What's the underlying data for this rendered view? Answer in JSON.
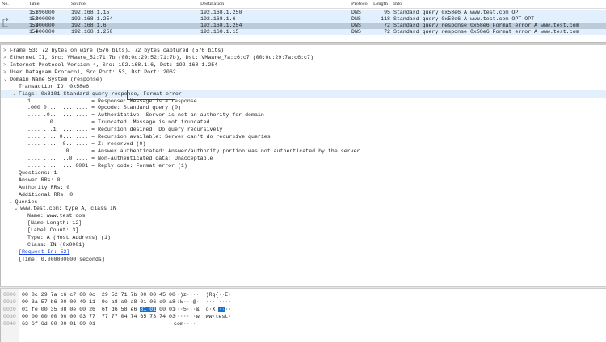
{
  "packet_list": {
    "columns": [
      "No.",
      "Time",
      "Source",
      "Destination",
      "Protocol",
      "Length",
      "Info"
    ],
    "rows": [
      {
        "no": "51",
        "time": "1.896000",
        "src": "192.168.1.15",
        "dst": "192.168.1.250",
        "proto": "DNS",
        "len": "95",
        "info": "Standard query 0x58e6 A www.test.com OPT",
        "selected": false
      },
      {
        "no": "52",
        "time": "1.900000",
        "src": "192.168.1.254",
        "dst": "192.168.1.6",
        "proto": "DNS",
        "len": "118",
        "info": "Standard query 0x58e6 A www.test.com OPT OPT",
        "selected": false
      },
      {
        "no": "53",
        "time": "1.900000",
        "src": "192.168.1.6",
        "dst": "192.168.1.254",
        "proto": "DNS",
        "len": "72",
        "info": "Standard query response 0x58e6 Format error A www.test.com",
        "selected": true
      },
      {
        "no": "54",
        "time": "1.900000",
        "src": "192.168.1.250",
        "dst": "192.168.1.15",
        "proto": "DNS",
        "len": "72",
        "info": "Standard query response 0x58e6 Format error A www.test.com",
        "selected": false
      }
    ]
  },
  "details": [
    {
      "i": 0,
      "a": ">",
      "t": "Frame 53: 72 bytes on wire (576 bits), 72 bytes captured (576 bits)"
    },
    {
      "i": 0,
      "a": ">",
      "t": "Ethernet II, Src: VMware_52:71:7b (00:0c:29:52:71:7b), Dst: VMware_7a:c6:c7 (00:0c:29:7a:c6:c7)"
    },
    {
      "i": 0,
      "a": ">",
      "t": "Internet Protocol Version 4, Src: 192.168.1.6, Dst: 192.168.1.254"
    },
    {
      "i": 0,
      "a": ">",
      "t": "User Datagram Protocol, Src Port: 53, Dst Port: 2062"
    },
    {
      "i": 0,
      "a": "v",
      "t": "Domain Name System (response)"
    },
    {
      "i": 1,
      "a": "",
      "t": "Transaction ID: 0x58e6"
    },
    {
      "i": 1,
      "a": "v",
      "t": "Flags: 0x8101 Standard query response, Format error",
      "sel": true
    },
    {
      "i": 2,
      "a": "",
      "t": "1... .... .... .... = Response: Message is a response"
    },
    {
      "i": 2,
      "a": "",
      "t": ".000 0... .... .... = Opcode: Standard query (0)"
    },
    {
      "i": 2,
      "a": "",
      "t": ".... .0.. .... .... = Authoritative: Server is not an authority for domain"
    },
    {
      "i": 2,
      "a": "",
      "t": ".... ..0. .... .... = Truncated: Message is not truncated"
    },
    {
      "i": 2,
      "a": "",
      "t": ".... ...1 .... .... = Recursion desired: Do query recursively"
    },
    {
      "i": 2,
      "a": "",
      "t": ".... .... 0... .... = Recursion available: Server can't do recursive queries"
    },
    {
      "i": 2,
      "a": "",
      "t": ".... .... .0.. .... = Z: reserved (0)"
    },
    {
      "i": 2,
      "a": "",
      "t": ".... .... ..0. .... = Answer authenticated: Answer/authority portion was not authenticated by the server"
    },
    {
      "i": 2,
      "a": "",
      "t": ".... .... ...0 .... = Non-authenticated data: Unacceptable"
    },
    {
      "i": 2,
      "a": "",
      "t": ".... .... .... 0001 = Reply code: Format error (1)"
    },
    {
      "i": 1,
      "a": "",
      "t": "Questions: 1"
    },
    {
      "i": 1,
      "a": "",
      "t": "Answer RRs: 0"
    },
    {
      "i": 1,
      "a": "",
      "t": "Authority RRs: 0"
    },
    {
      "i": 1,
      "a": "",
      "t": "Additional RRs: 0"
    },
    {
      "i": 0.6,
      "a": "v",
      "t": "Queries"
    },
    {
      "i": 1.2,
      "a": "v",
      "t": "www.test.com: type A, class IN"
    },
    {
      "i": 2,
      "a": "",
      "t": "Name: www.test.com"
    },
    {
      "i": 2,
      "a": "",
      "t": "[Name Length: 12]"
    },
    {
      "i": 2,
      "a": "",
      "t": "[Label Count: 3]"
    },
    {
      "i": 2,
      "a": "",
      "t": "Type: A (Host Address) (1)"
    },
    {
      "i": 2,
      "a": "",
      "t": "Class: IN (0x0001)"
    },
    {
      "i": 1,
      "a": "",
      "t": "[Request In: 52]",
      "link": true
    },
    {
      "i": 1,
      "a": "",
      "t": "[Time: 0.000000000 seconds]"
    }
  ],
  "bytes": [
    {
      "off": "0000",
      "hex": "00 0c 29 7a c6 c7 00 0c  29 52 71 7b 00 00 45 00",
      "ascii": "··)z····  )Rq{··E·"
    },
    {
      "off": "0010",
      "hex": "00 3a 57 b6 00 00 40 11  9e a8 c0 a8 01 06 c0 a8",
      "ascii": "·:W···@·  ········"
    },
    {
      "off": "0020",
      "hex_a": "01 fe 00 35 08 0e 00 26  6f d6 58 e6 ",
      "hex_sel": "81 01",
      "hex_b": " 00 01",
      "ascii_a": "···5···&  o·X·",
      "ascii_sel": "··",
      "ascii_b": "··"
    },
    {
      "off": "0030",
      "hex": "00 00 00 00 00 00 03 77  77 77 04 74 65 73 74 03",
      "ascii": "·······w  ww·test·"
    },
    {
      "off": "0040",
      "hex": "63 6f 6d 00 00 01 00 01",
      "ascii": "com····"
    }
  ],
  "colors": {
    "row_bg": "#e2f0fd",
    "row_selected": "#bccbd9",
    "highlight": "#1a73d0",
    "annotation_box": "#e00000",
    "link": "#1a3fe0"
  }
}
